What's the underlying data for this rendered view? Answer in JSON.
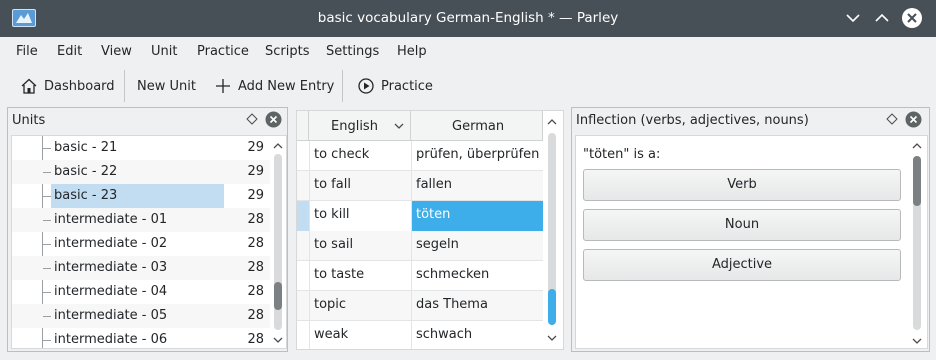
{
  "window": {
    "title": "basic vocabulary German-English * — Parley"
  },
  "menubar": {
    "items": [
      "File",
      "Edit",
      "View",
      "Unit",
      "Practice",
      "Scripts",
      "Settings",
      "Help"
    ]
  },
  "toolbar": {
    "dashboard": "Dashboard",
    "new_unit": "New Unit",
    "add_new_entry": "Add New Entry",
    "practice": "Practice"
  },
  "units_panel": {
    "title": "Units",
    "items": [
      {
        "name": "basic - 21",
        "count": "29"
      },
      {
        "name": "basic - 22",
        "count": "29"
      },
      {
        "name": "basic - 23",
        "count": "29",
        "selected": true
      },
      {
        "name": "intermediate - 01",
        "count": "28"
      },
      {
        "name": "intermediate - 02",
        "count": "28"
      },
      {
        "name": "intermediate - 03",
        "count": "28"
      },
      {
        "name": "intermediate - 04",
        "count": "28"
      },
      {
        "name": "intermediate - 05",
        "count": "28"
      },
      {
        "name": "intermediate - 06",
        "count": "28"
      }
    ]
  },
  "vocabulary": {
    "columns": [
      "English",
      "German"
    ],
    "rows": [
      {
        "en": "to check",
        "de": "prüfen, überprüfen"
      },
      {
        "en": "to fall",
        "de": "fallen"
      },
      {
        "en": "to kill",
        "de": "töten",
        "selected": true
      },
      {
        "en": "to sail",
        "de": "segeln"
      },
      {
        "en": "to taste",
        "de": "schmecken"
      },
      {
        "en": "topic",
        "de": "das Thema"
      },
      {
        "en": "weak",
        "de": "schwach"
      }
    ]
  },
  "inflection_panel": {
    "title": "Inflection (verbs, adjectives, nouns)",
    "question": "\"töten\" is a:",
    "buttons": [
      "Verb",
      "Noun",
      "Adjective"
    ]
  },
  "colors": {
    "titlebar": "#475057",
    "selection": "#3daee9",
    "tree_selection": "#c2dcf2"
  }
}
